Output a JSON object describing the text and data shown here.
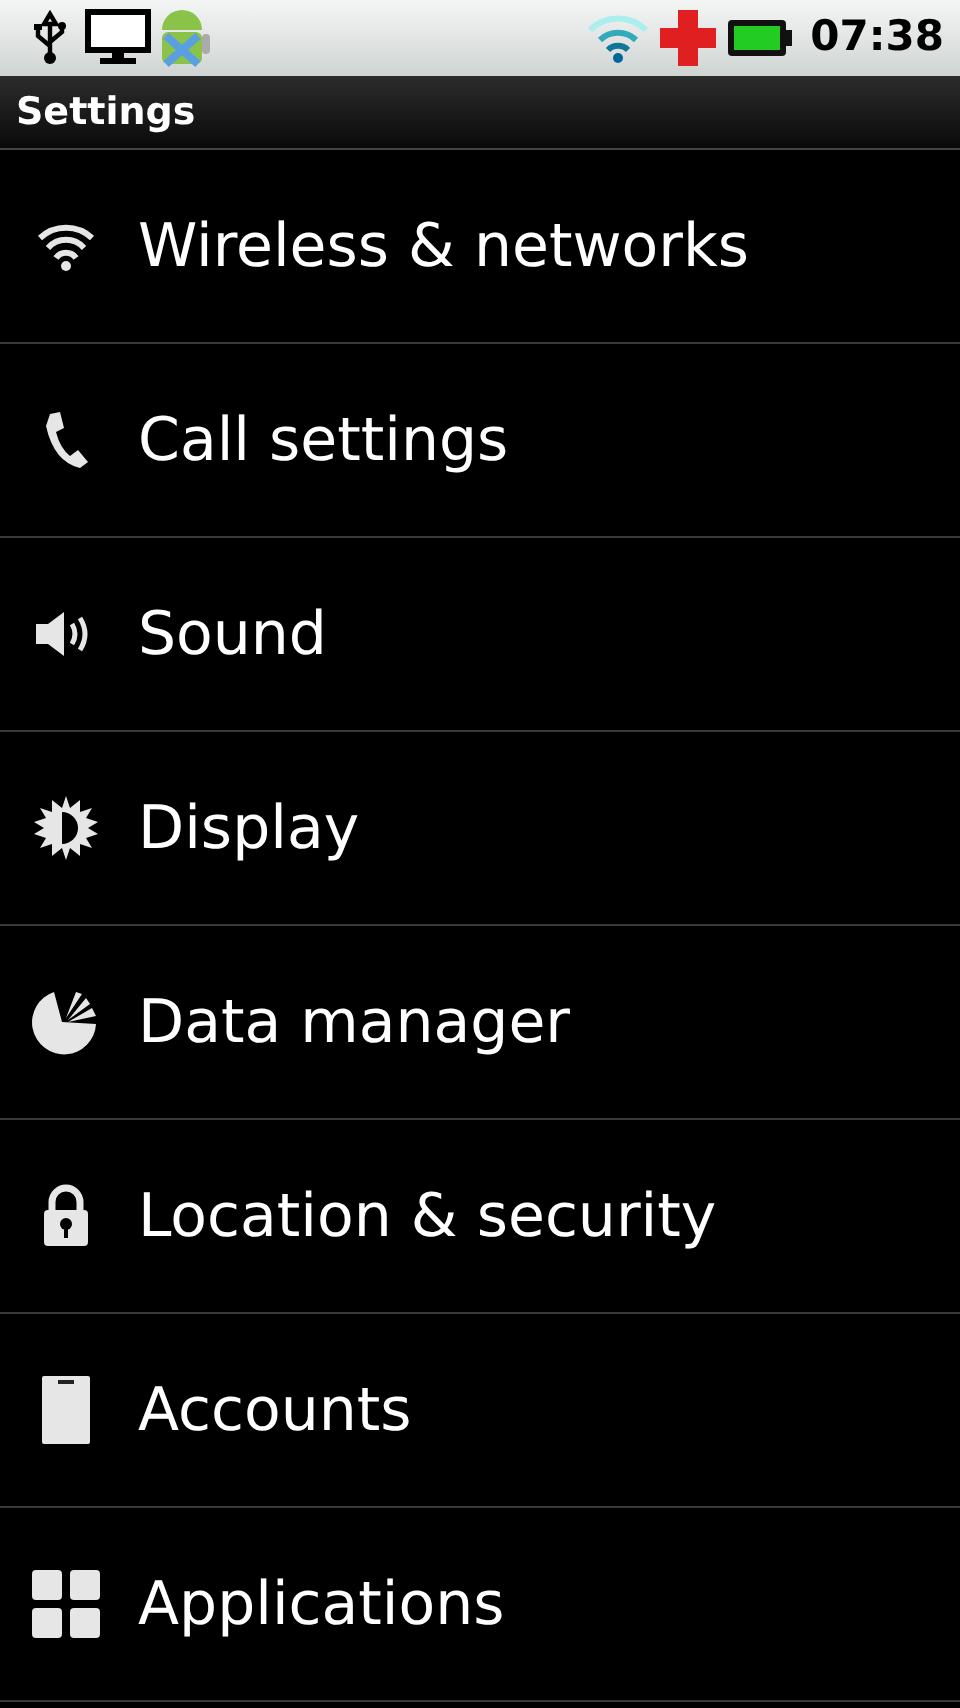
{
  "status_bar": {
    "time": "07:38"
  },
  "title": "Settings",
  "items": [
    {
      "label": "Wireless & networks"
    },
    {
      "label": "Call settings"
    },
    {
      "label": "Sound"
    },
    {
      "label": "Display"
    },
    {
      "label": "Data manager"
    },
    {
      "label": "Location & security"
    },
    {
      "label": "Accounts"
    },
    {
      "label": "Applications"
    }
  ]
}
